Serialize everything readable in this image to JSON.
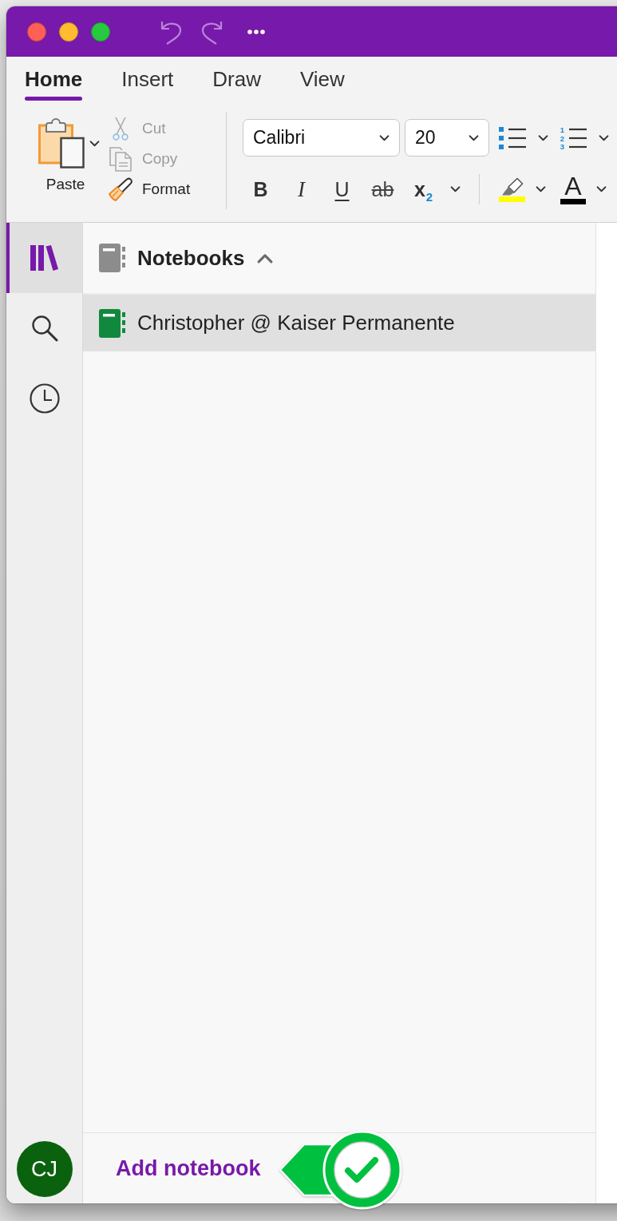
{
  "ribbon": {
    "tabs": [
      {
        "label": "Home",
        "selected": true
      },
      {
        "label": "Insert",
        "selected": false
      },
      {
        "label": "Draw",
        "selected": false
      },
      {
        "label": "View",
        "selected": false
      }
    ],
    "clipboard": {
      "paste": "Paste",
      "actions": [
        {
          "kind": "cut",
          "label": "Cut",
          "disabled": true
        },
        {
          "kind": "copy",
          "label": "Copy",
          "disabled": true
        },
        {
          "kind": "format_painter",
          "label": "Format",
          "disabled": false
        }
      ]
    },
    "font": {
      "family": "Calibri",
      "size": "20"
    },
    "lists": [
      {
        "kind": "bullets"
      },
      {
        "kind": "numbering",
        "numbers": [
          "1",
          "2",
          "3"
        ]
      }
    ],
    "formatting": [
      {
        "kind": "bold",
        "label": "B"
      },
      {
        "kind": "italic",
        "label": "I"
      },
      {
        "kind": "underline",
        "label": "U"
      },
      {
        "kind": "strikethrough",
        "label": "ab"
      },
      {
        "kind": "subscript",
        "label": "x$_{2}$"
      }
    ],
    "colors": [
      {
        "kind": "highlight",
        "color": "#ffff00"
      },
      {
        "kind": "font_color",
        "label": "A",
        "color": "#000000"
      }
    ]
  },
  "rail": {
    "items": [
      {
        "kind": "notebooks",
        "selected": true
      },
      {
        "kind": "search",
        "selected": false
      },
      {
        "kind": "recent",
        "selected": false
      }
    ],
    "avatar": "CJ"
  },
  "notebooks": {
    "title": "Notebooks",
    "expanded": true,
    "items": [
      {
        "name": "Christopher @ Kaiser Permanente",
        "selected": true,
        "color": "#10893e"
      }
    ],
    "add_label": "Add notebook"
  }
}
